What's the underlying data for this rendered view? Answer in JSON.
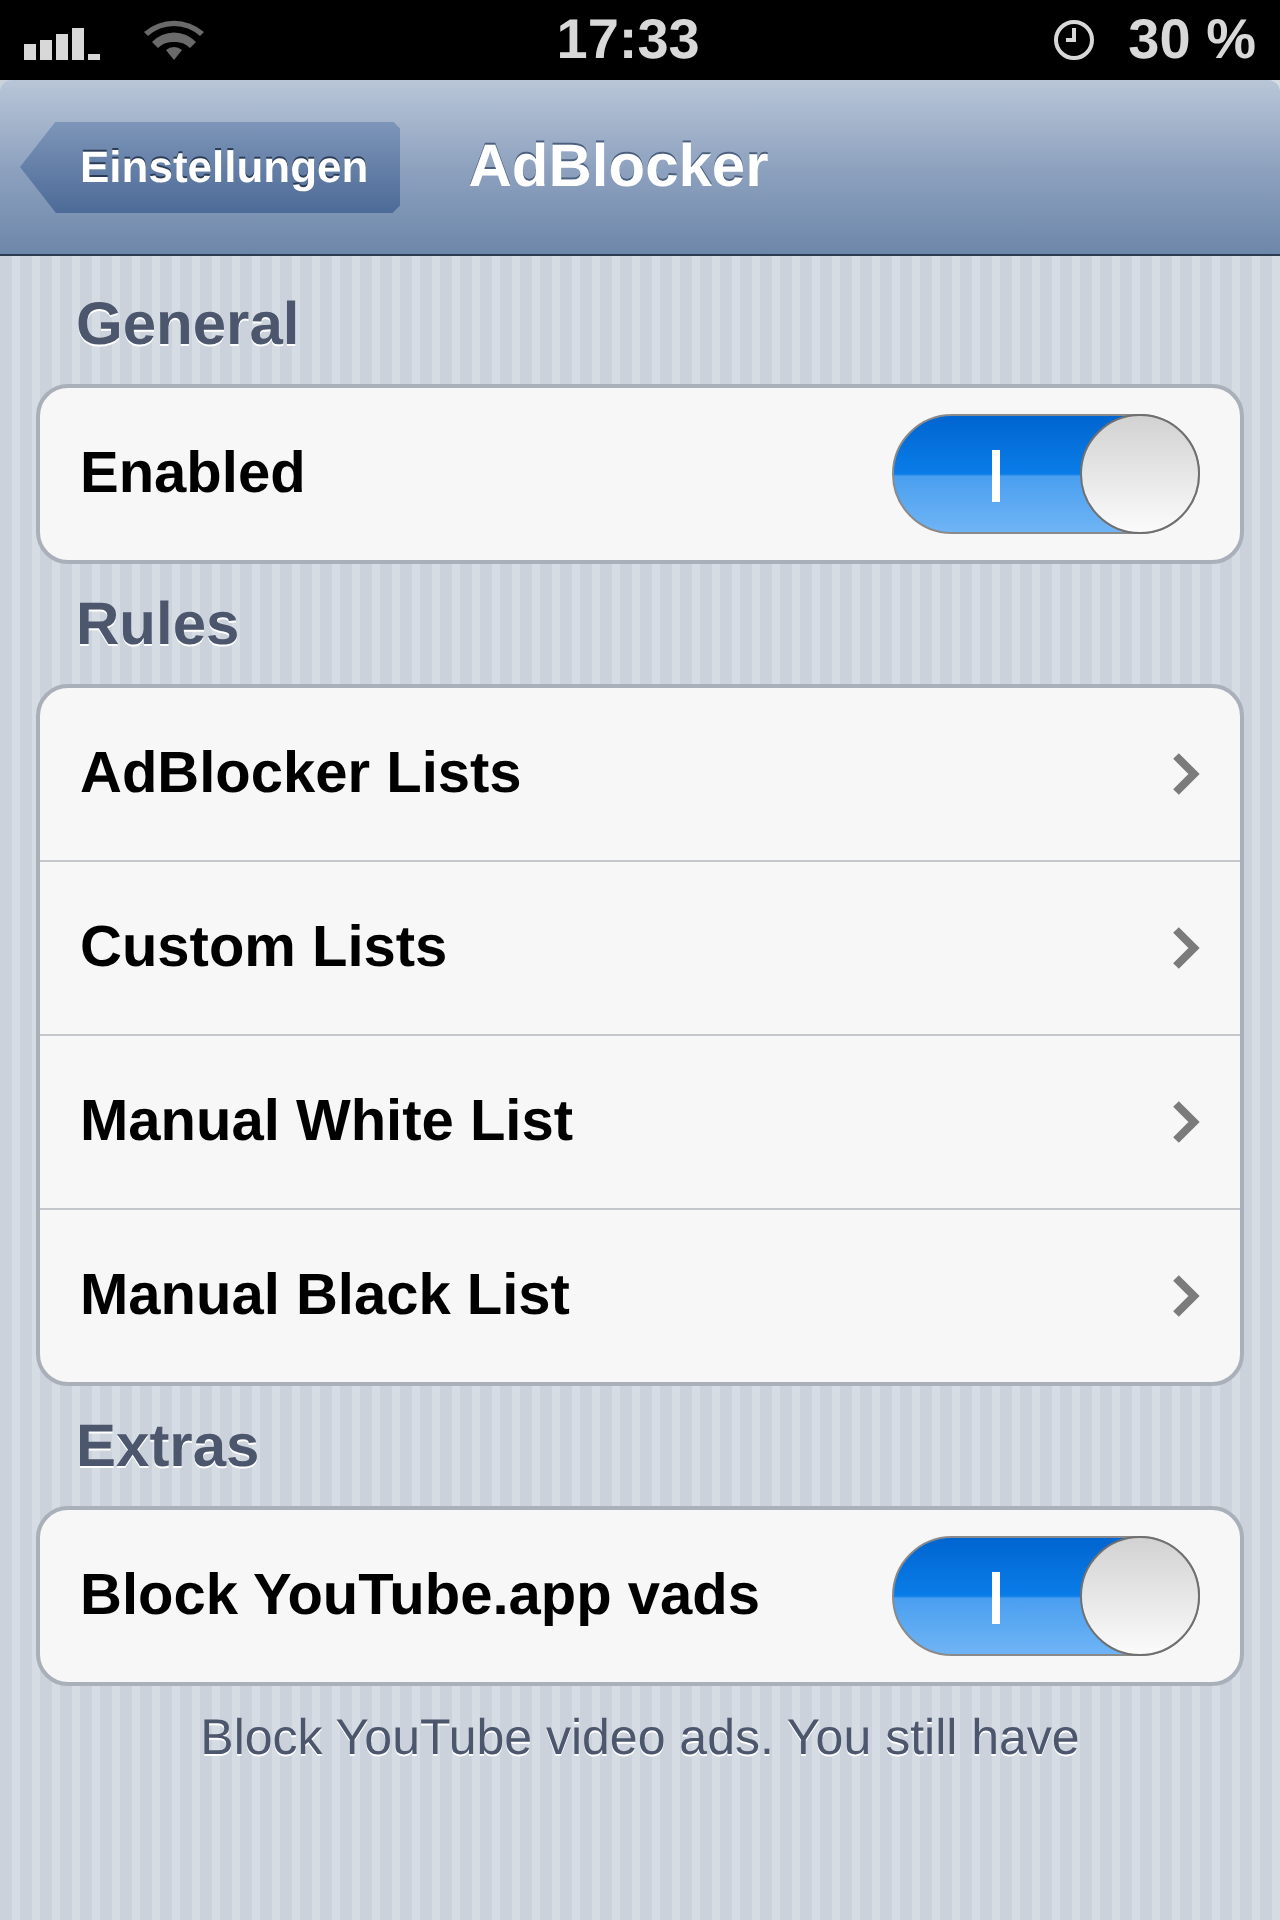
{
  "status_bar": {
    "time": "17:33",
    "battery": "30 %"
  },
  "nav_bar": {
    "back": "Einstellungen",
    "title": "AdBlocker"
  },
  "sections": [
    {
      "header": "General",
      "rows": [
        {
          "kind": "switch",
          "label": "Enabled",
          "on": true
        }
      ]
    },
    {
      "header": "Rules",
      "rows": [
        {
          "kind": "link",
          "label": "AdBlocker Lists"
        },
        {
          "kind": "link",
          "label": "Custom Lists"
        },
        {
          "kind": "link",
          "label": "Manual White List"
        },
        {
          "kind": "link",
          "label": "Manual Black List"
        }
      ]
    },
    {
      "header": "Extras",
      "rows": [
        {
          "kind": "switch",
          "label": "Block YouTube.app vads",
          "on": true
        }
      ],
      "footer": "Block YouTube video ads. You still have"
    }
  ]
}
